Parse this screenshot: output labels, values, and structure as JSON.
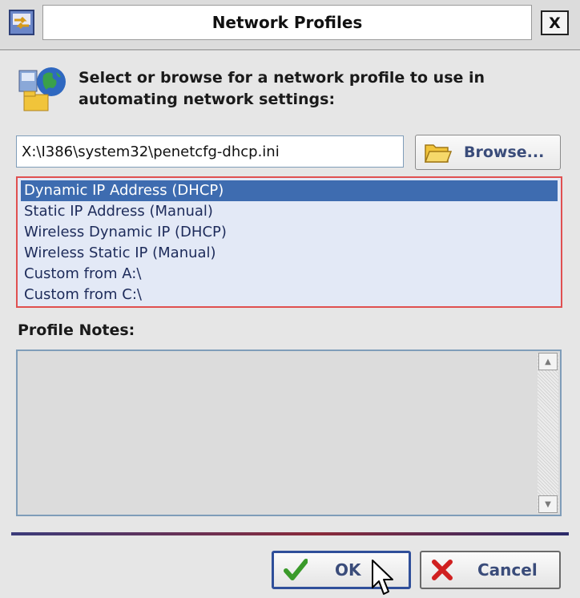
{
  "window": {
    "title": "Network Profiles",
    "close_label": "X"
  },
  "header": {
    "instruction": "Select or browse for a network profile to use in automating network settings:"
  },
  "path_field": {
    "value": "X:\\I386\\system32\\penetcfg-dhcp.ini"
  },
  "browse_button": {
    "label": "Browse..."
  },
  "profiles": {
    "selected_index": 0,
    "items": [
      {
        "label": "Dynamic IP Address (DHCP)"
      },
      {
        "label": "Static IP Address (Manual)"
      },
      {
        "label": "Wireless Dynamic IP (DHCP)"
      },
      {
        "label": "Wireless Static IP (Manual)"
      },
      {
        "label": "Custom from A:\\"
      },
      {
        "label": "Custom from C:\\"
      }
    ]
  },
  "notes": {
    "label": "Profile Notes:",
    "value": ""
  },
  "buttons": {
    "ok": "OK",
    "cancel": "Cancel"
  },
  "colors": {
    "selection": "#3e6cb0",
    "list_border": "#e05050",
    "ok_check": "#3a9a2a",
    "cancel_x": "#d02020"
  }
}
